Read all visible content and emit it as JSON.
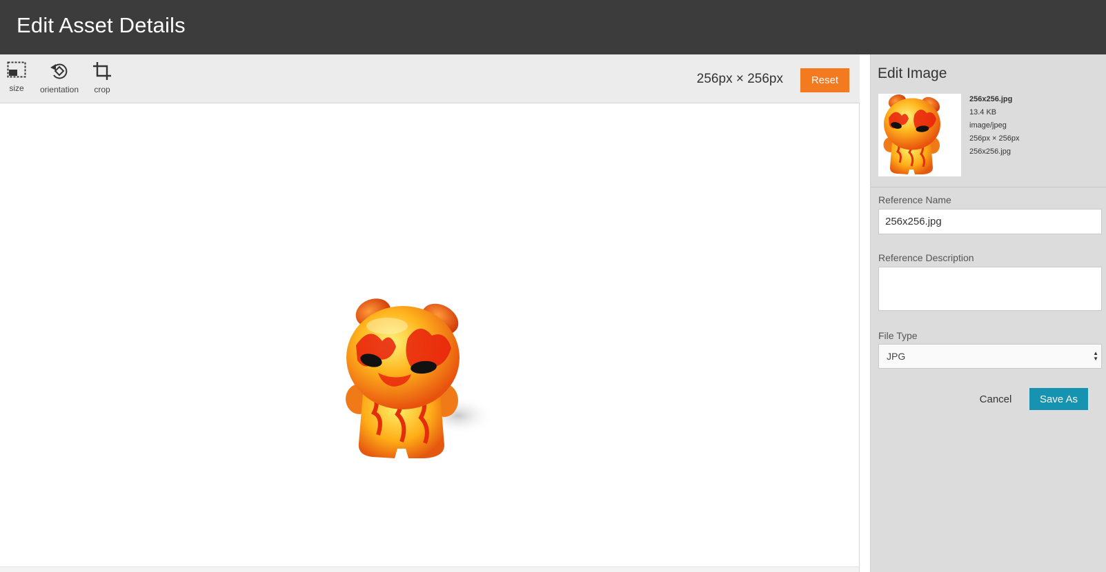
{
  "header": {
    "title": "Edit Asset Details"
  },
  "toolbar": {
    "tools": [
      {
        "label": "size",
        "icon": "size-icon"
      },
      {
        "label": "orientation",
        "icon": "rotate-icon"
      },
      {
        "label": "crop",
        "icon": "crop-icon"
      }
    ],
    "dimensions": "256px × 256px",
    "reset_label": "Reset"
  },
  "canvas": {
    "image": "fire-bear-toy-image"
  },
  "panel": {
    "title": "Edit Image",
    "meta": {
      "filename": "256x256.jpg",
      "size": "13.4 KB",
      "mime": "image/jpeg",
      "dimensions": "256px × 256px",
      "path": "256x256.jpg"
    },
    "reference_name_label": "Reference Name",
    "reference_name_value": "256x256.jpg",
    "reference_description_label": "Reference Description",
    "reference_description_value": "",
    "file_type_label": "File Type",
    "file_type_value": "JPG",
    "cancel_label": "Cancel",
    "save_label": "Save As"
  },
  "colors": {
    "header_bg": "#3c3c3c",
    "accent_orange": "#f47a20",
    "accent_teal": "#1593b0",
    "panel_bg": "#dcdcdc"
  }
}
